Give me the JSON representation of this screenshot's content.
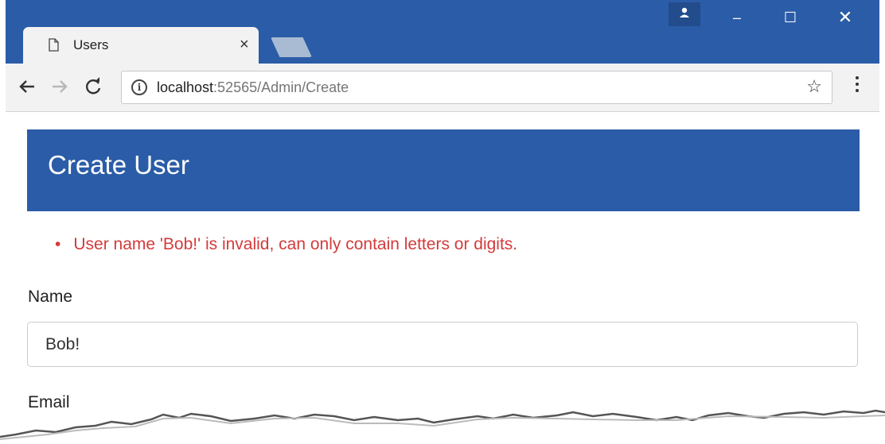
{
  "browser": {
    "tab_title": "Users",
    "tab_close": "×",
    "url_host": "localhost",
    "url_path": ":52565/Admin/Create",
    "window_controls": {
      "minimize": "–",
      "maximize": "☐",
      "close": "✕"
    },
    "icons": {
      "tab": "document-icon",
      "back": "back-arrow-icon",
      "forward": "forward-arrow-icon",
      "reload": "reload-icon",
      "info": "info-icon",
      "star": "star-icon",
      "menu": "kebab-menu-icon",
      "profile": "user-profile-icon"
    }
  },
  "page": {
    "header_title": "Create User",
    "errors": [
      "User name 'Bob!' is invalid, can only contain letters or digits."
    ],
    "fields": {
      "name": {
        "label": "Name",
        "value": "Bob!"
      },
      "email": {
        "label": "Email"
      }
    }
  },
  "colors": {
    "brand_blue": "#2b5ca7",
    "error_red": "#d33b3b",
    "toolbar_gray": "#f2f2f2"
  }
}
